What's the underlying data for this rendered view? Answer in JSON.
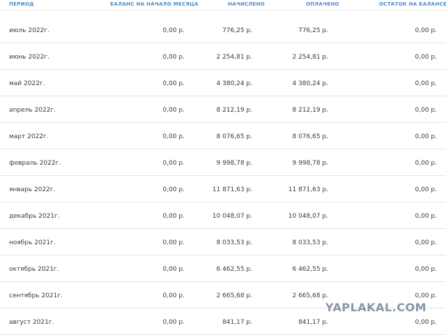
{
  "columns": {
    "period": "ПЕРИОД",
    "opening_balance": "БАЛАНС НА НАЧАЛО МЕСЯЦА",
    "accrued": "НАЧИСЛЕНО",
    "paid": "ОПЛАЧЕНО",
    "remaining": "ОСТАТОК НА БАЛАНСЕ"
  },
  "rows": [
    {
      "period": "июль 2022г.",
      "opening_balance": "0,00 р.",
      "accrued": "776,25 р.",
      "paid": "776,25 р.",
      "remaining": "0,00 р."
    },
    {
      "period": "июнь 2022г.",
      "opening_balance": "0,00 р.",
      "accrued": "2 254,81 р.",
      "paid": "2 254,81 р.",
      "remaining": "0,00 р."
    },
    {
      "period": "май 2022г.",
      "opening_balance": "0,00 р.",
      "accrued": "4 380,24 р.",
      "paid": "4 380,24 р.",
      "remaining": "0,00 р."
    },
    {
      "period": "апрель 2022г.",
      "opening_balance": "0,00 р.",
      "accrued": "8 212,19 р.",
      "paid": "8 212,19 р.",
      "remaining": "0,00 р."
    },
    {
      "period": "март 2022г.",
      "opening_balance": "0,00 р.",
      "accrued": "8 076,65 р.",
      "paid": "8 076,65 р.",
      "remaining": "0,00 р."
    },
    {
      "period": "февраль 2022г.",
      "opening_balance": "0,00 р.",
      "accrued": "9 998,78 р.",
      "paid": "9 998,78 р.",
      "remaining": "0,00 р."
    },
    {
      "period": "январь 2022г.",
      "opening_balance": "0,00 р.",
      "accrued": "11 871,63 р.",
      "paid": "11 871,63 р.",
      "remaining": "0,00 р."
    },
    {
      "period": "декабрь 2021г.",
      "opening_balance": "0,00 р.",
      "accrued": "10 048,07 р.",
      "paid": "10 048,07 р.",
      "remaining": "0,00 р."
    },
    {
      "period": "ноябрь 2021г.",
      "opening_balance": "0,00 р.",
      "accrued": "8 033,53 р.",
      "paid": "8 033,53 р.",
      "remaining": "0,00 р."
    },
    {
      "period": "октябрь 2021г.",
      "opening_balance": "0,00 р.",
      "accrued": "6 462,55 р.",
      "paid": "6 462,55 р.",
      "remaining": "0,00 р."
    },
    {
      "period": "сентябрь 2021г.",
      "opening_balance": "0,00 р.",
      "accrued": "2 665,68 р.",
      "paid": "2 665,68 р.",
      "remaining": "0,00 р."
    },
    {
      "period": "август 2021г.",
      "opening_balance": "0,00 р.",
      "accrued": "841,17 р.",
      "paid": "841,17 р.",
      "remaining": "0,00 р."
    }
  ],
  "watermark": "YAPLAKAL.COM"
}
